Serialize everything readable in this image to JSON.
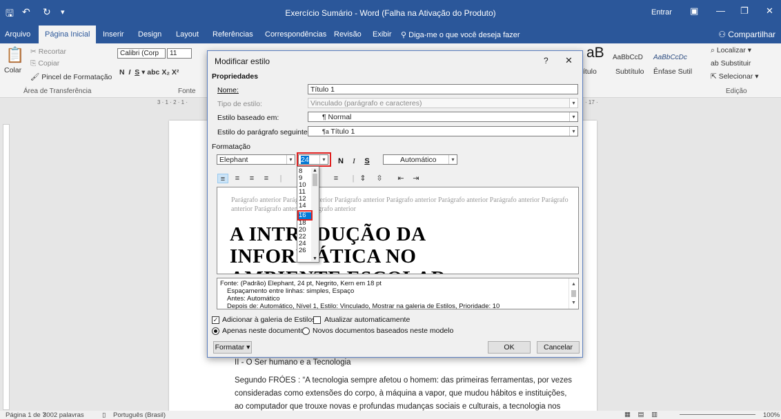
{
  "window": {
    "title": "Exercício Sumário  -  Word (Falha na Ativação do Produto)",
    "signin": "Entrar"
  },
  "tabs": [
    "Arquivo",
    "Página Inicial",
    "Inserir",
    "Design",
    "Layout",
    "Referências",
    "Correspondências",
    "Revisão",
    "Exibir"
  ],
  "tellme": "Diga-me o que você deseja fazer",
  "share": "Compartilhar",
  "ribbon": {
    "cut": "Recortar",
    "copy": "Copiar",
    "paste": "Colar",
    "painter": "Pincel de Formatação",
    "clipboard_group": "Área de Transferência",
    "font_name": "Calibri (Corp",
    "font_size": "11",
    "font_group": "Fonte",
    "style_big": "aB",
    "styles": [
      "ítulo",
      "AaBbCcD",
      "AaBbCcDc",
      "Subtítulo",
      "Ênfase Sutil"
    ],
    "find": "Localizar",
    "replace": "Substituir",
    "select": "Selecionar",
    "edit_group": "Edição"
  },
  "ruler_top_left": "3 · 1 · 2 · 1 ·",
  "ruler_top_right": "· 17 ·",
  "document": {
    "heading2": "II - O Ser humano e a Tecnologia",
    "lines": [
      "Segundo FRÓES : “A tecnologia sempre afetou o homem: das primeiras ferramentas, por vezes",
      "consideradas como extensões do corpo, à máquina a vapor, que mudou hábitos e instituições,",
      "ao computador que trouxe novas e profundas mudanças sociais e culturais, a tecnologia nos"
    ]
  },
  "status": {
    "page": "Página 1 de 7",
    "words": "3002 palavras",
    "lang": "Português (Brasil)",
    "zoom": "100%"
  },
  "dialog": {
    "title": "Modificar estilo",
    "help": "?",
    "close": "✕",
    "properties_label": "Propriedades",
    "name_label": "Nome:",
    "name_value": "Título 1",
    "type_label": "Tipo de estilo:",
    "type_value": "Vinculado (parágrafo e caracteres)",
    "based_label": "Estilo baseado em:",
    "based_value": "¶ Normal",
    "next_label": "Estilo do parágrafo seguinte:",
    "next_value": "Título 1",
    "format_label": "Formatação",
    "font_value": "Elephant",
    "size_value": "24",
    "color_value": "Automático",
    "bold": "N",
    "italic": "I",
    "underline": "S",
    "size_options": [
      "8",
      "9",
      "10",
      "11",
      "12",
      "14",
      "16",
      "18",
      "20",
      "22",
      "24",
      "26"
    ],
    "size_highlighted": "16",
    "preview_prev": "Parágrafo anterior Parágrafo anterior Parágrafo anterior Parágrafo anterior Parágrafo anterior Parágrafo anterior Parágrafo anterior Parágrafo anterior Parágrafo anterior",
    "preview_line1": "A INTRODUÇÃO DA",
    "preview_line2": "INFORMÁTICA NO",
    "preview_line3": "AMBIENTE ESCOLAR",
    "desc1": "Fonte: (Padrão) Elephant, 24 pt, Negrito, Kern em 18 pt",
    "desc2": "Espaçamento entre linhas:  simples, Espaço",
    "desc3": "Antes:  Automático",
    "desc4": "Depois de:  Automático, Nível 1, Estilo: Vinculado, Mostrar na galeria de Estilos, Prioridade: 10",
    "add_gallery": "Adicionar à galeria de Estilos",
    "auto_update": "Atualizar automaticamente",
    "only_doc": "Apenas neste documento",
    "new_docs": "Novos documentos baseados neste modelo",
    "format_btn": "Formatar ▾",
    "ok": "OK",
    "cancel": "Cancelar"
  },
  "colors": {
    "word_blue": "#2b579a",
    "highlight_red": "#e02020",
    "select_blue": "#0078d7"
  }
}
